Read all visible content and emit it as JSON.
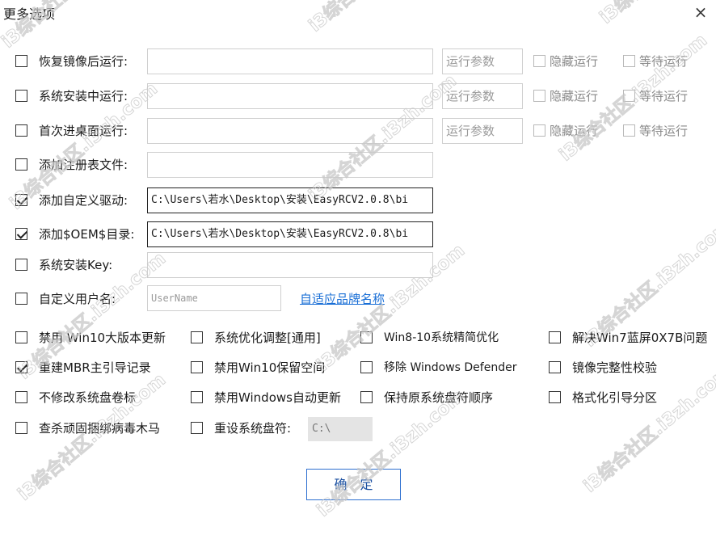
{
  "window": {
    "title": "更多选项",
    "close_glyph": "×"
  },
  "run_rows": [
    {
      "label": "恢复镜像后运行:",
      "value": "",
      "param_placeholder": "运行参数",
      "hide_label": "隐藏运行",
      "wait_label": "等待运行"
    },
    {
      "label": "系统安装中运行:",
      "value": "",
      "param_placeholder": "运行参数",
      "hide_label": "隐藏运行",
      "wait_label": "等待运行"
    },
    {
      "label": "首次进桌面运行:",
      "value": "",
      "param_placeholder": "运行参数",
      "hide_label": "隐藏运行",
      "wait_label": "等待运行"
    }
  ],
  "registry": {
    "label": "添加注册表文件:",
    "value": ""
  },
  "driver": {
    "label": "添加自定义驱动:",
    "value": "C:\\Users\\若水\\Desktop\\安装\\EasyRCV2.0.8\\bi"
  },
  "oem": {
    "label": "添加$OEM$目录:",
    "value": "C:\\Users\\若水\\Desktop\\安装\\EasyRCV2.0.8\\bi"
  },
  "key": {
    "label": "系统安装Key:",
    "value": ""
  },
  "username": {
    "label": "自定义用户名:",
    "placeholder": "UserName",
    "link": "自适应品牌名称"
  },
  "options": [
    {
      "label": "禁用 Win10大版本更新",
      "checked": false
    },
    {
      "label": "系统优化调整[通用]",
      "checked": false
    },
    {
      "label": "Win8-10系统精简优化",
      "checked": false
    },
    {
      "label": "解决Win7蓝屏0X7B问题",
      "checked": false
    },
    {
      "label": "重建MBR主引导记录",
      "checked": true
    },
    {
      "label": "禁用Win10保留空间",
      "checked": false
    },
    {
      "label": "移除 Windows Defender",
      "checked": false
    },
    {
      "label": "镜像完整性校验",
      "checked": false
    },
    {
      "label": "不修改系统盘卷标",
      "checked": false
    },
    {
      "label": "禁用Windows自动更新",
      "checked": false
    },
    {
      "label": "保持原系统盘符顺序",
      "checked": false
    },
    {
      "label": "格式化引导分区",
      "checked": false
    },
    {
      "label": "查杀顽固捆绑病毒木马",
      "checked": false
    }
  ],
  "reset_drive": {
    "label": "重设系统盘符:",
    "value": "C:\\"
  },
  "confirm_label": "确定",
  "watermark": "i3综合社区.i3zh.com",
  "colors": {
    "link": "#1a6fd6",
    "button_border": "#2d6fd0"
  }
}
